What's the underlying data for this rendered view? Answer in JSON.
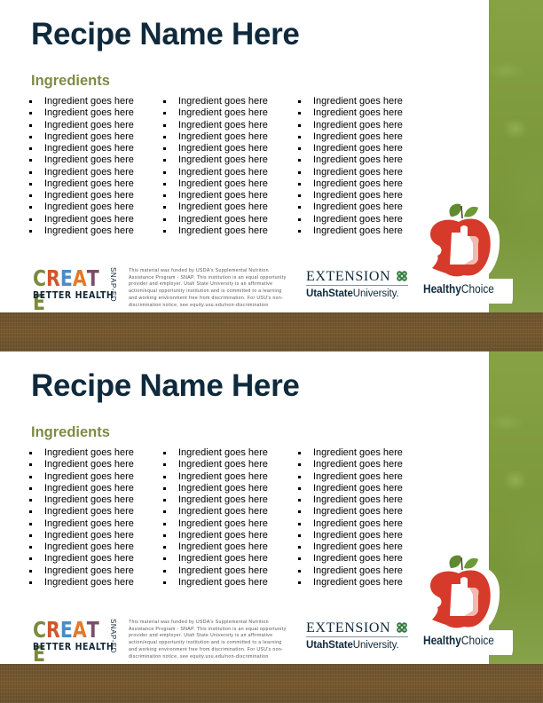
{
  "cards": [
    {
      "title": "Recipe Name Here",
      "ingredients_heading": "Ingredients",
      "columns": [
        [
          "Ingredient goes here",
          "Ingredient goes here",
          "Ingredient goes here",
          "Ingredient goes here",
          "Ingredient goes here",
          "Ingredient goes here",
          "Ingredient goes here",
          "Ingredient goes here",
          "Ingredient goes here",
          "Ingredient goes here",
          "Ingredient goes here",
          "Ingredient goes here"
        ],
        [
          "Ingredient goes here",
          "Ingredient goes here",
          "Ingredient goes here",
          "Ingredient goes here",
          "Ingredient goes here",
          "Ingredient goes here",
          "Ingredient goes here",
          "Ingredient goes here",
          "Ingredient goes here",
          "Ingredient goes here",
          "Ingredient goes here",
          "Ingredient goes here"
        ],
        [
          "Ingredient goes here",
          "Ingredient goes here",
          "Ingredient goes here",
          "Ingredient goes here",
          "Ingredient goes here",
          "Ingredient goes here",
          "Ingredient goes here",
          "Ingredient goes here",
          "Ingredient goes here",
          "Ingredient goes here",
          "Ingredient goes here",
          "Ingredient goes here"
        ]
      ]
    },
    {
      "title": "Recipe Name Here",
      "ingredients_heading": "Ingredients",
      "columns": [
        [
          "Ingredient goes here",
          "Ingredient goes here",
          "Ingredient goes here",
          "Ingredient goes here",
          "Ingredient goes here",
          "Ingredient goes here",
          "Ingredient goes here",
          "Ingredient goes here",
          "Ingredient goes here",
          "Ingredient goes here",
          "Ingredient goes here",
          "Ingredient goes here"
        ],
        [
          "Ingredient goes here",
          "Ingredient goes here",
          "Ingredient goes here",
          "Ingredient goes here",
          "Ingredient goes here",
          "Ingredient goes here",
          "Ingredient goes here",
          "Ingredient goes here",
          "Ingredient goes here",
          "Ingredient goes here",
          "Ingredient goes here",
          "Ingredient goes here"
        ],
        [
          "Ingredient goes here",
          "Ingredient goes here",
          "Ingredient goes here",
          "Ingredient goes here",
          "Ingredient goes here",
          "Ingredient goes here",
          "Ingredient goes here",
          "Ingredient goes here",
          "Ingredient goes here",
          "Ingredient goes here",
          "Ingredient goes here",
          "Ingredient goes here"
        ]
      ]
    }
  ],
  "footer": {
    "create_logo": {
      "letters": [
        {
          "char": "C",
          "color": "#7b8a3c"
        },
        {
          "char": "R",
          "color": "#d2552b"
        },
        {
          "char": "E",
          "color": "#4b8cc4"
        },
        {
          "char": "A",
          "color": "#e07a2a"
        },
        {
          "char": "T",
          "color": "#7a4e6a"
        },
        {
          "char": "E",
          "color": "#7b8a3c"
        }
      ],
      "tagline": "BETTER HEALTH",
      "side_label": "SNAP-ED"
    },
    "disclaimer": "This material was funded by USDA's Supplemental Nutrition Assistance Program - SNAP. This institution is an equal opportunity provider and employer. Utah State University is an affirmative action/equal opportunity institution and is committed to a learning and working environment free from discrimination. For USU's non-discrimination notice, see equity.usu.edu/non-discrimination",
    "extension_logo": {
      "word": "EXTENSION",
      "university_bold": "UtahState",
      "university_regular": "University."
    },
    "healthy_choice_logo": {
      "bold": "Healthy",
      "regular": "Choice"
    }
  },
  "colors": {
    "title": "#0f2a3c",
    "ingredients_heading": "#7d8b45",
    "green_strip": "#7d9a3c",
    "brown_band": "#72572f",
    "apple_red": "#d63a2a",
    "leaf_green": "#5f8a2e"
  },
  "icons": [
    "bullet-square-icon",
    "four-h-clover-icon",
    "apple-thumbs-up-icon"
  ]
}
